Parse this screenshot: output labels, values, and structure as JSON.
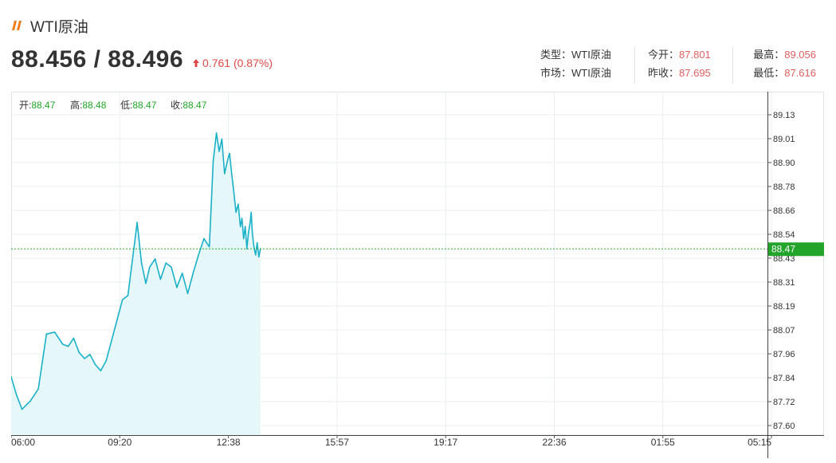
{
  "header": {
    "title": "WTI原油",
    "price": "88.456 / 88.496",
    "change": "0.761 (0.87%)"
  },
  "info": {
    "type_label": "类型：",
    "type_value": "WTI原油",
    "market_label": "市场：",
    "market_value": "WTI原油",
    "open_label": "今开：",
    "open_value": "87.801",
    "prev_close_label": "昨收：",
    "prev_close_value": "87.695",
    "high_label": "最高：",
    "high_value": "89.056",
    "low_label": "最低：",
    "low_value": "87.616"
  },
  "ohlc_legend": {
    "open_label": "开:",
    "open_value": "88.47",
    "high_label": "高:",
    "high_value": "88.48",
    "low_label": "低:",
    "low_value": "88.47",
    "close_label": "收:",
    "close_value": "88.47"
  },
  "colors": {
    "line": "#1ab1c8",
    "area_fill": "#e6f7f9",
    "current_price": "#22a52a",
    "up": "#e04848",
    "brand": "#f07d18",
    "grid": "#e9eef0"
  },
  "chart_data": {
    "type": "area",
    "title": "",
    "xlabel": "",
    "ylabel": "",
    "x_ticks": [
      "06:00",
      "09:20",
      "12:38",
      "15:57",
      "19:17",
      "22:36",
      "01:55",
      "05:15"
    ],
    "y_ticks": [
      "87.60",
      "87.72",
      "87.84",
      "87.96",
      "88.07",
      "88.19",
      "88.31",
      "88.43",
      "88.54",
      "88.66",
      "88.78",
      "88.90",
      "89.01",
      "89.13"
    ],
    "ylim": [
      87.56,
      89.2
    ],
    "grid": true,
    "current_price": 88.47,
    "current_price_label": "88.47",
    "series": [
      {
        "x": [
          "06:00",
          "06:10",
          "06:20",
          "06:35",
          "06:50",
          "07:05",
          "07:20",
          "07:35",
          "07:45",
          "07:55",
          "08:05",
          "08:15",
          "08:25",
          "08:35",
          "08:45",
          "08:55",
          "09:05",
          "09:15",
          "09:25",
          "09:35",
          "09:45",
          "09:52",
          "10:00",
          "10:08",
          "10:15",
          "10:25",
          "10:35",
          "10:45",
          "10:55",
          "11:05",
          "11:15",
          "11:25",
          "11:35",
          "11:45",
          "11:55",
          "12:05",
          "12:12",
          "12:18",
          "12:23",
          "12:28",
          "12:33",
          "12:38",
          "12:42",
          "12:46",
          "12:50",
          "12:54",
          "12:58",
          "13:02",
          "13:05",
          "13:08",
          "13:11",
          "13:14",
          "13:17",
          "13:20",
          "13:22",
          "13:24",
          "13:27",
          "13:30",
          "13:33",
          "13:36",
          "13:39"
        ],
        "y": [
          87.84,
          87.75,
          87.68,
          87.72,
          87.78,
          88.05,
          88.06,
          88.0,
          87.99,
          88.03,
          87.96,
          87.93,
          87.95,
          87.9,
          87.87,
          87.92,
          88.02,
          88.12,
          88.22,
          88.24,
          88.45,
          88.6,
          88.4,
          88.3,
          88.38,
          88.42,
          88.32,
          88.4,
          88.38,
          88.28,
          88.35,
          88.25,
          88.35,
          88.44,
          88.52,
          88.48,
          88.9,
          89.04,
          88.95,
          89.01,
          88.84,
          88.9,
          88.94,
          88.84,
          88.75,
          88.65,
          88.69,
          88.58,
          88.62,
          88.52,
          88.58,
          88.47,
          88.55,
          88.6,
          88.65,
          88.55,
          88.48,
          88.44,
          88.5,
          88.43,
          88.47
        ]
      }
    ]
  }
}
